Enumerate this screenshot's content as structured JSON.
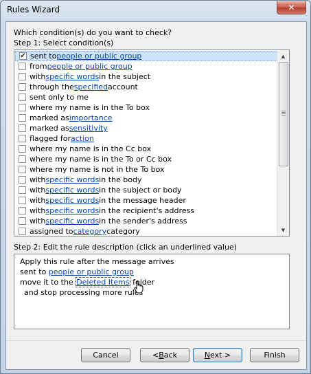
{
  "window": {
    "title": "Rules Wizard",
    "close_glyph": "✕"
  },
  "question": "Which condition(s) do you want to check?",
  "step1_label": "Step 1: Select condition(s)",
  "conditions": [
    {
      "checked": true,
      "parts": [
        "sent to ",
        "people or public group",
        ""
      ]
    },
    {
      "checked": false,
      "parts": [
        "from ",
        "people or public group",
        ""
      ]
    },
    {
      "checked": false,
      "parts": [
        "with ",
        "specific words",
        " in the subject"
      ]
    },
    {
      "checked": false,
      "parts": [
        "through the ",
        "specified",
        " account"
      ]
    },
    {
      "checked": false,
      "parts": [
        "sent only to me",
        "",
        ""
      ]
    },
    {
      "checked": false,
      "parts": [
        "where my name is in the To box",
        "",
        ""
      ]
    },
    {
      "checked": false,
      "parts": [
        "marked as ",
        "importance",
        ""
      ]
    },
    {
      "checked": false,
      "parts": [
        "marked as ",
        "sensitivity",
        ""
      ]
    },
    {
      "checked": false,
      "parts": [
        "flagged for ",
        "action",
        ""
      ]
    },
    {
      "checked": false,
      "parts": [
        "where my name is in the Cc box",
        "",
        ""
      ]
    },
    {
      "checked": false,
      "parts": [
        "where my name is in the To or Cc box",
        "",
        ""
      ]
    },
    {
      "checked": false,
      "parts": [
        "where my name is not in the To box",
        "",
        ""
      ]
    },
    {
      "checked": false,
      "parts": [
        "with ",
        "specific words",
        " in the body"
      ]
    },
    {
      "checked": false,
      "parts": [
        "with ",
        "specific words",
        " in the subject or body"
      ]
    },
    {
      "checked": false,
      "parts": [
        "with ",
        "specific words",
        " in the message header"
      ]
    },
    {
      "checked": false,
      "parts": [
        "with ",
        "specific words",
        " in the recipient's address"
      ]
    },
    {
      "checked": false,
      "parts": [
        "with ",
        "specific words",
        " in the sender's address"
      ]
    },
    {
      "checked": false,
      "parts": [
        "assigned to ",
        "category",
        " category"
      ]
    }
  ],
  "step2_label": "Step 2: Edit the rule description (click an underlined value)",
  "description": {
    "line1": "Apply this rule after the message arrives",
    "line2_pre": "sent to ",
    "line2_link": "people or public group",
    "line3_pre": "move it to the ",
    "line3_link": "Deleted Items",
    "line3_post": " folder",
    "line4": "and stop processing more rules"
  },
  "buttons": {
    "cancel": "Cancel",
    "back_pre": "< ",
    "back_mn": "B",
    "back_post": "ack",
    "next_pre": "",
    "next_mn": "N",
    "next_post": "ext >",
    "finish": "Finish"
  },
  "icons": {
    "scroll_up": "▲",
    "scroll_down": "▼",
    "check": "✔",
    "cursor": "hand-pointer-icon"
  }
}
